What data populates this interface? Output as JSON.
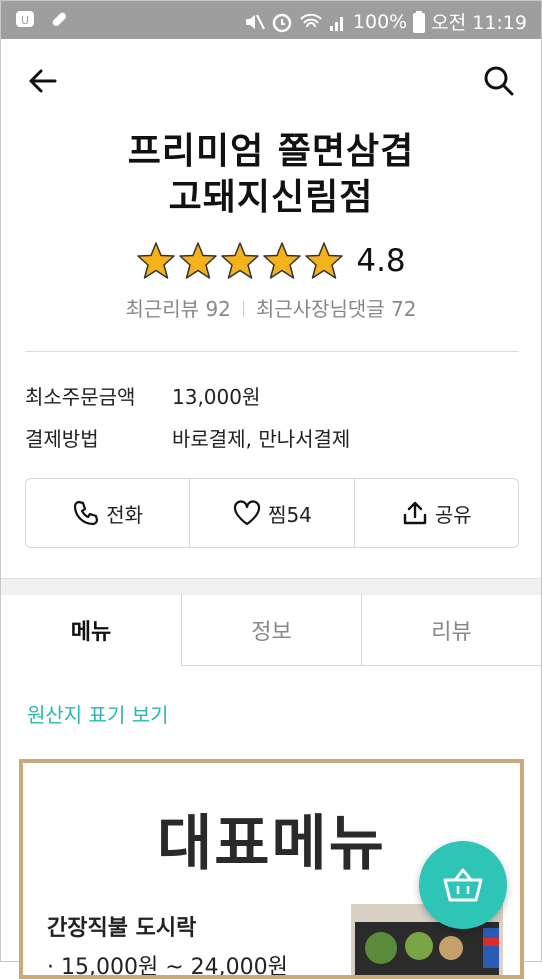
{
  "status": {
    "battery": "100%",
    "time": "오전 11:19"
  },
  "store": {
    "name_line1": "프리미엄 쫄면삼겹",
    "name_line2": "고돼지신림점",
    "rating": "4.8",
    "stars": 5,
    "recent_reviews": "최근리뷰 92",
    "owner_replies": "최근사장님댓글 72"
  },
  "info": {
    "min_order_label": "최소주문금액",
    "min_order_value": "13,000원",
    "payment_label": "결제방법",
    "payment_value": "바로결제, 만나서결제"
  },
  "actions": {
    "call": "전화",
    "like": "찜54",
    "share": "공유"
  },
  "tabs": [
    "메뉴",
    "정보",
    "리뷰"
  ],
  "origin_link": "원산지 표기 보기",
  "banner": {
    "title": "대표메뉴",
    "item_name": "간장직불 도시락",
    "item_price": "· 15,000원 ~ 24,000원"
  },
  "icons": [
    "back-arrow-icon",
    "search-icon",
    "phone-icon",
    "heart-icon",
    "share-icon",
    "basket-icon"
  ],
  "colors": {
    "accent": "#2ec4b6",
    "link": "#2ab7b0",
    "star": "#f5b21a",
    "banner_border": "#c9a97e"
  }
}
